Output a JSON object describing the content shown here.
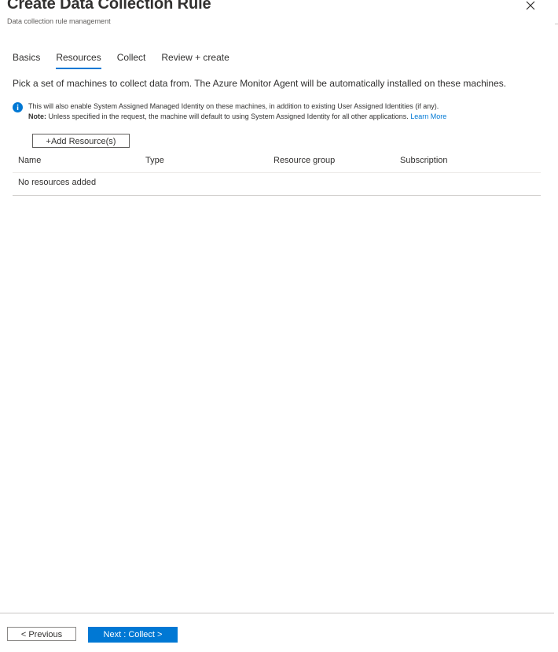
{
  "header": {
    "title": "Create Data Collection Rule",
    "subtitle": "Data collection rule management",
    "close_icon": "close-icon"
  },
  "tabs": [
    {
      "label": "Basics",
      "active": false
    },
    {
      "label": "Resources",
      "active": true
    },
    {
      "label": "Collect",
      "active": false
    },
    {
      "label": "Review + create",
      "active": false
    }
  ],
  "intro_text": "Pick a set of machines to collect data from. The Azure Monitor Agent will be automatically installed on these machines.",
  "info": {
    "icon": "info-icon",
    "line1": "This will also enable System Assigned Managed Identity on these machines, in addition to existing User Assigned Identities (if any).",
    "note_label": "Note:",
    "line2": " Unless specified in the request, the machine will default to using System Assigned Identity for all other applications.",
    "learn_more": "Learn More"
  },
  "add_button_label": "+Add Resource(s)",
  "table": {
    "columns": [
      "Name",
      "Type",
      "Resource group",
      "Subscription"
    ],
    "empty_text": "No resources added"
  },
  "footer": {
    "previous_label": "< Previous",
    "next_label": "Next : Collect >"
  },
  "colors": {
    "accent": "#0078d4",
    "text": "#323130"
  }
}
